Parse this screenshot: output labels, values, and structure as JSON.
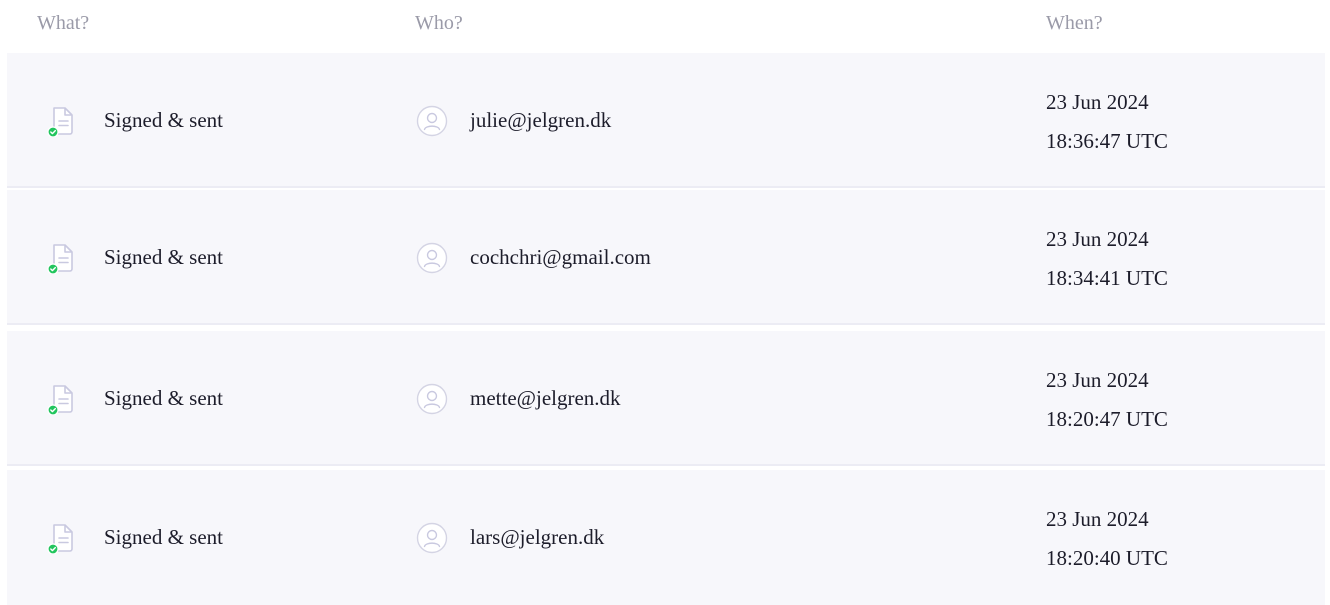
{
  "header": {
    "what": "What?",
    "who": "Who?",
    "when": "When?"
  },
  "colors": {
    "row_bg": "#f7f7fb",
    "divider": "#ececf4",
    "check_green": "#22c55e",
    "icon_stroke": "#c9c9e0",
    "header_text": "#9a9aa8"
  },
  "rows": [
    {
      "action": "Signed & sent",
      "icon": "document-signed-icon",
      "user_icon": "user-circle-icon",
      "email": "julie@jelgren.dk",
      "date": "23 Jun 2024",
      "time": "18:36:47 UTC"
    },
    {
      "action": "Signed & sent",
      "icon": "document-signed-icon",
      "user_icon": "user-circle-icon",
      "email": "cochchri@gmail.com",
      "date": "23 Jun 2024",
      "time": "18:34:41 UTC"
    },
    {
      "action": "Signed & sent",
      "icon": "document-signed-icon",
      "user_icon": "user-circle-icon",
      "email": "mette@jelgren.dk",
      "date": "23 Jun 2024",
      "time": "18:20:47 UTC"
    },
    {
      "action": "Signed & sent",
      "icon": "document-signed-icon",
      "user_icon": "user-circle-icon",
      "email": "lars@jelgren.dk",
      "date": "23 Jun 2024",
      "time": "18:20:40 UTC"
    }
  ]
}
